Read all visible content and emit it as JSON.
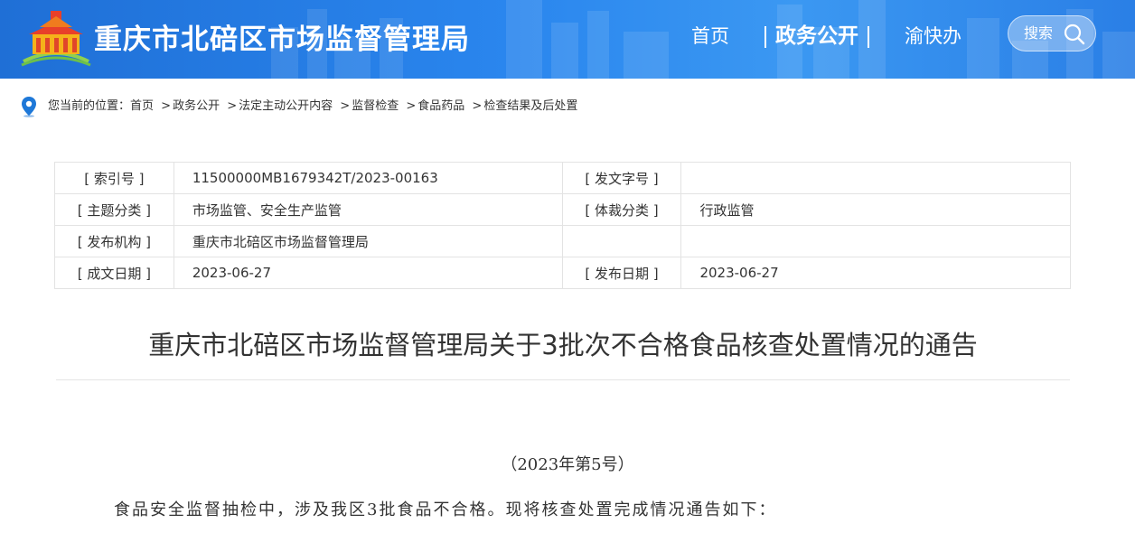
{
  "header": {
    "site_title": "重庆市北碚区市场监督管理局",
    "nav": {
      "home": "首页",
      "gov": "政务公开",
      "yukuaiban": "渝快办"
    },
    "search_label": "搜索"
  },
  "breadcrumb": {
    "prefix": "您当前的位置：",
    "items": [
      "首页",
      "政务公开",
      "法定主动公开内容",
      "监督检查",
      "食品药品",
      "检查结果及后处置"
    ],
    "separator": ">"
  },
  "info_table": {
    "rows": [
      {
        "k1": "[ 索引号 ]",
        "v1": "11500000MB1679342T/2023-00163",
        "k2": "[ 发文字号 ]",
        "v2": ""
      },
      {
        "k1": "[ 主题分类 ]",
        "v1": "市场监管、安全生产监管",
        "k2": "[ 体裁分类 ]",
        "v2": "行政监管"
      },
      {
        "k1": "[ 发布机构 ]",
        "v1": "重庆市北碚区市场监督管理局",
        "k2": "",
        "v2": ""
      },
      {
        "k1": "[ 成文日期 ]",
        "v1": "2023-06-27",
        "k2": "[ 发布日期 ]",
        "v2": "2023-06-27"
      }
    ]
  },
  "article": {
    "title": "重庆市北碚区市场监督管理局关于3批次不合格食品核查处置情况的通告",
    "doc_number": "（2023年第5号）",
    "paragraph_1": "食品安全监督抽检中，涉及我区3批食品不合格。现将核查处置完成情况通告如下："
  },
  "colors": {
    "header_blue": "#2a86ee",
    "text": "#333333",
    "border": "#e3e3e3",
    "pin_blue": "#1e78d8"
  },
  "icons": {
    "logo": "bureau-logo",
    "search": "search-icon",
    "location": "location-pin-icon"
  }
}
